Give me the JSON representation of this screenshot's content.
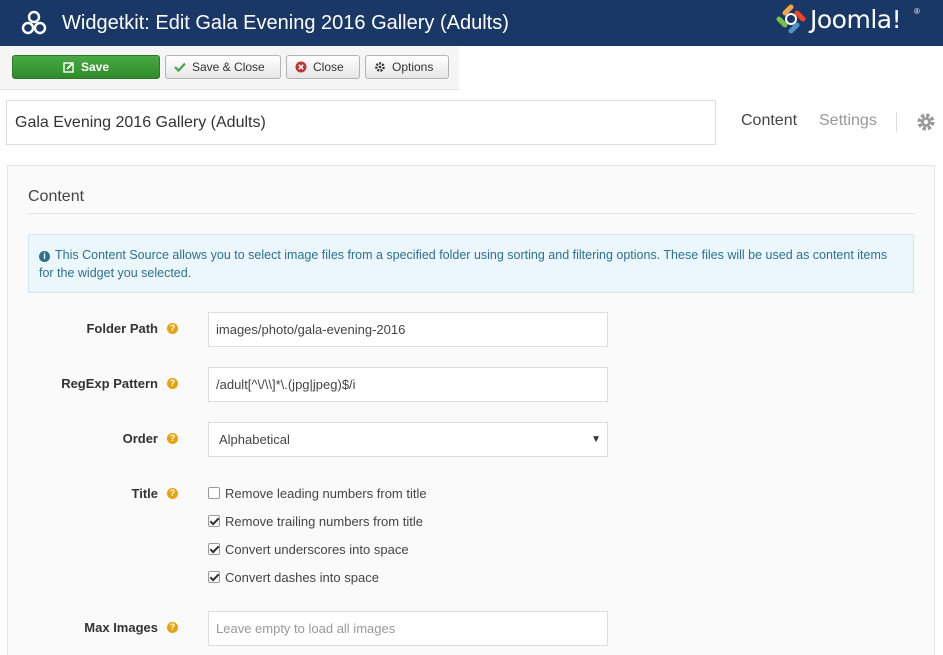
{
  "header": {
    "title": "Widgetkit: Edit Gala Evening 2016 Gallery (Adults)",
    "brand": "Joomla!",
    "brand_reg": "®",
    "header_bg": "#1a3867"
  },
  "toolbar": {
    "save_label": "Save",
    "save_close_label": "Save & Close",
    "close_label": "Close",
    "options_label": "Options"
  },
  "item": {
    "title_value": "Gala Evening 2016 Gallery (Adults)"
  },
  "tabs": {
    "content": "Content",
    "settings": "Settings"
  },
  "panel": {
    "heading": "Content",
    "info_text": "This Content Source allows you to select image files from a specified folder using sorting and filtering options. These files will be used as content items for the widget you selected."
  },
  "form": {
    "folder_path": {
      "label": "Folder Path",
      "value": "images/photo/gala-evening-2016"
    },
    "regexp": {
      "label": "RegExp Pattern",
      "value": "/adult[^\\/\\\\]*\\.(jpg|jpeg)$/i"
    },
    "order": {
      "label": "Order",
      "selected": "Alphabetical"
    },
    "title": {
      "label": "Title",
      "options": [
        {
          "label": "Remove leading numbers from title",
          "checked": false
        },
        {
          "label": "Remove trailing numbers from title",
          "checked": true
        },
        {
          "label": "Convert underscores into space",
          "checked": true
        },
        {
          "label": "Convert dashes into space",
          "checked": true
        }
      ]
    },
    "max_images": {
      "label": "Max Images",
      "placeholder": "Leave empty to load all images"
    }
  },
  "colors": {
    "save_green": "#3a9a34",
    "help_orange": "#e8a30b",
    "info_blue": "#2d7091"
  }
}
